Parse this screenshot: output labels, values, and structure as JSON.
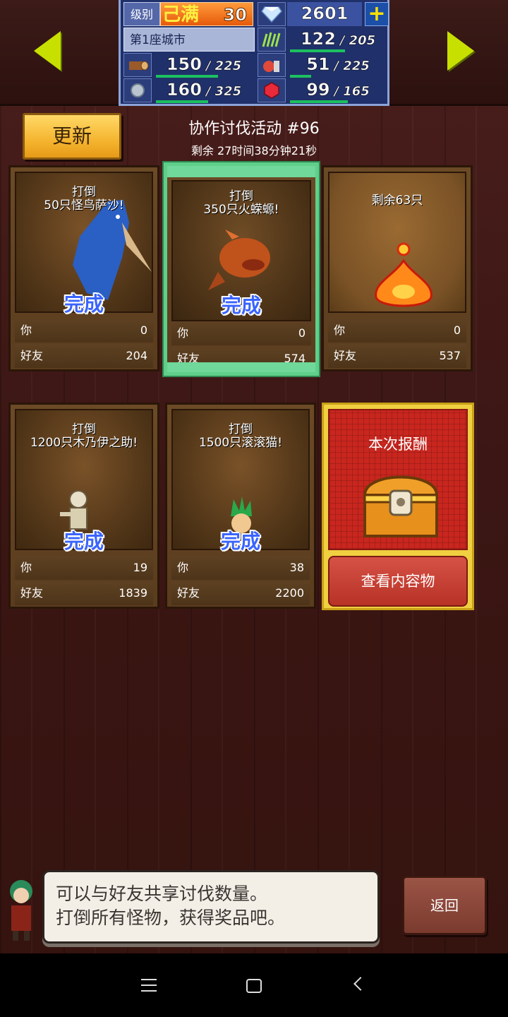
{
  "status": {
    "level_label": "级别",
    "level_max_label": "己满",
    "level": "30",
    "gems": "2601",
    "city": "第1座城市",
    "grass": {
      "value": "122",
      "max": "205"
    },
    "wood": {
      "value": "150",
      "max": "225"
    },
    "food": {
      "value": "51",
      "max": "225"
    },
    "ore": {
      "value": "160",
      "max": "325"
    },
    "ruby": {
      "value": "99",
      "max": "165"
    }
  },
  "header": {
    "update_label": "更新",
    "event_title": "协作讨伐活动 #96",
    "timer": "剩余 27时间38分钟21秒"
  },
  "labels": {
    "you": "你",
    "friend": "好友",
    "done": "完成"
  },
  "cards": [
    {
      "title_line1": "打倒",
      "title_line2": "50只怪鸟萨沙!",
      "done": true,
      "you": "0",
      "friend": "204"
    },
    {
      "title_line1": "打倒",
      "title_line2": "350只火蝾螈!",
      "done": true,
      "you": "0",
      "friend": "574"
    },
    {
      "title_line1": "剩余63只",
      "title_line2": "",
      "done": false,
      "you": "0",
      "friend": "537"
    },
    {
      "title_line1": "打倒",
      "title_line2": "1200只木乃伊之助!",
      "done": true,
      "you": "19",
      "friend": "1839"
    },
    {
      "title_line1": "打倒",
      "title_line2": "1500只滚滚猫!",
      "done": true,
      "you": "38",
      "friend": "2200"
    }
  ],
  "reward": {
    "title": "本次报酬",
    "button": "查看内容物"
  },
  "message": {
    "line1": "可以与好友共享讨伐数量。",
    "line2": "打倒所有怪物，获得奖品吧。"
  },
  "back_label": "返回",
  "colors": {
    "accent_green": "#5fcf8a",
    "done_blue": "#3a64ff",
    "update_gold": "#f5b530",
    "reward_red": "#c8261e"
  }
}
